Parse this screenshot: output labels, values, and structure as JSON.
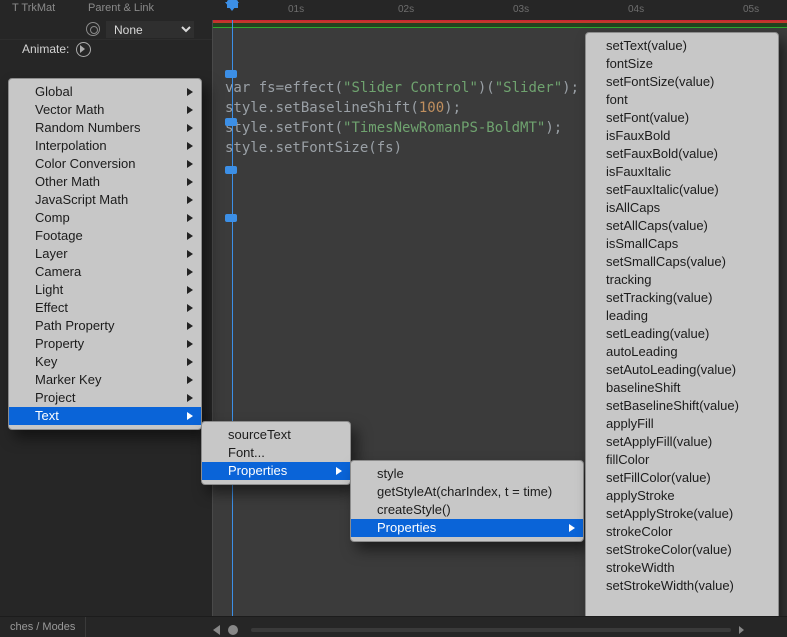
{
  "header": {
    "col_trkmat": "T  TrkMat",
    "col_parentlink": "Parent & Link",
    "ruler_ticks": [
      "01s",
      "02s",
      "03s",
      "04s",
      "05s"
    ]
  },
  "leftPanel": {
    "parent_none": "None",
    "animate_label": "Animate:"
  },
  "code": {
    "line1_a": "var ",
    "line1_b": "fs=effect(",
    "line1_s1": "\"Slider Control\"",
    "line1_c": ")(",
    "line1_s2": "\"Slider\"",
    "line1_d": ");",
    "line2_a": "style.setBaselineShift(",
    "line2_n": "100",
    "line2_b": ");",
    "line3_a": "style.setFont(",
    "line3_s": "\"TimesNewRomanPS-BoldMT\"",
    "line3_b": ");",
    "line4": "style.setFontSize(fs)"
  },
  "menu1": {
    "items": [
      "Global",
      "Vector Math",
      "Random Numbers",
      "Interpolation",
      "Color Conversion",
      "Other Math",
      "JavaScript Math",
      "Comp",
      "Footage",
      "Layer",
      "Camera",
      "Light",
      "Effect",
      "Path Property",
      "Property",
      "Key",
      "Marker Key",
      "Project",
      "Text"
    ]
  },
  "menu2": {
    "items": [
      "sourceText",
      "Font...",
      "Properties"
    ]
  },
  "menu3": {
    "items": [
      "style",
      "getStyleAt(charIndex, t = time)",
      "createStyle()",
      "Properties"
    ]
  },
  "menu4": {
    "items": [
      "setText(value)",
      "fontSize",
      "setFontSize(value)",
      "font",
      "setFont(value)",
      "isFauxBold",
      "setFauxBold(value)",
      "isFauxItalic",
      "setFauxItalic(value)",
      "isAllCaps",
      "setAllCaps(value)",
      "isSmallCaps",
      "setSmallCaps(value)",
      "tracking",
      "setTracking(value)",
      "leading",
      "setLeading(value)",
      "autoLeading",
      "setAutoLeading(value)",
      "baselineShift",
      "setBaselineShift(value)",
      "applyFill",
      "setApplyFill(value)",
      "fillColor",
      "setFillColor(value)",
      "applyStroke",
      "setApplyStroke(value)",
      "strokeColor",
      "setStrokeColor(value)",
      "strokeWidth",
      "setStrokeWidth(value)"
    ]
  },
  "footer": {
    "left_label": "ches / Modes"
  }
}
